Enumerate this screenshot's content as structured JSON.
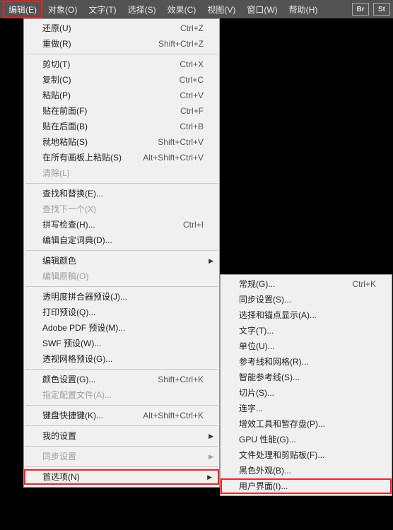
{
  "menubar": {
    "items": [
      "编辑(E)",
      "对象(O)",
      "文字(T)",
      "选择(S)",
      "效果(C)",
      "视图(V)",
      "窗口(W)",
      "帮助(H)"
    ],
    "icons": [
      "Br",
      "St"
    ]
  },
  "mainMenu": [
    {
      "type": "item",
      "label": "还原(U)",
      "shortcut": "Ctrl+Z"
    },
    {
      "type": "item",
      "label": "重做(R)",
      "shortcut": "Shift+Ctrl+Z"
    },
    {
      "type": "sep"
    },
    {
      "type": "item",
      "label": "剪切(T)",
      "shortcut": "Ctrl+X"
    },
    {
      "type": "item",
      "label": "复制(C)",
      "shortcut": "Ctrl+C"
    },
    {
      "type": "item",
      "label": "粘贴(P)",
      "shortcut": "Ctrl+V"
    },
    {
      "type": "item",
      "label": "贴在前面(F)",
      "shortcut": "Ctrl+F"
    },
    {
      "type": "item",
      "label": "贴在后面(B)",
      "shortcut": "Ctrl+B"
    },
    {
      "type": "item",
      "label": "就地粘贴(S)",
      "shortcut": "Shift+Ctrl+V"
    },
    {
      "type": "item",
      "label": "在所有画板上粘贴(S)",
      "shortcut": "Alt+Shift+Ctrl+V"
    },
    {
      "type": "item",
      "label": "清除(L)",
      "disabled": true
    },
    {
      "type": "sep"
    },
    {
      "type": "item",
      "label": "查找和替换(E)..."
    },
    {
      "type": "item",
      "label": "查找下一个(X)",
      "disabled": true
    },
    {
      "type": "item",
      "label": "拼写检查(H)...",
      "shortcut": "Ctrl+I"
    },
    {
      "type": "item",
      "label": "编辑自定词典(D)..."
    },
    {
      "type": "sep"
    },
    {
      "type": "item",
      "label": "编辑颜色",
      "submenu": true
    },
    {
      "type": "item",
      "label": "编辑原稿(O)",
      "disabled": true
    },
    {
      "type": "sep"
    },
    {
      "type": "item",
      "label": "透明度拼合器预设(J)..."
    },
    {
      "type": "item",
      "label": "打印预设(Q)..."
    },
    {
      "type": "item",
      "label": "Adobe PDF 预设(M)..."
    },
    {
      "type": "item",
      "label": "SWF 预设(W)..."
    },
    {
      "type": "item",
      "label": "透视网格预设(G)..."
    },
    {
      "type": "sep"
    },
    {
      "type": "item",
      "label": "颜色设置(G)...",
      "shortcut": "Shift+Ctrl+K"
    },
    {
      "type": "item",
      "label": "指定配置文件(A)...",
      "disabled": true
    },
    {
      "type": "sep"
    },
    {
      "type": "item",
      "label": "键盘快捷键(K)...",
      "shortcut": "Alt+Shift+Ctrl+K"
    },
    {
      "type": "sep"
    },
    {
      "type": "item",
      "label": "我的设置",
      "submenu": true
    },
    {
      "type": "sep"
    },
    {
      "type": "item",
      "label": "同步设置",
      "submenu": true,
      "disabled": true
    },
    {
      "type": "sep"
    },
    {
      "type": "item",
      "label": "首选项(N)",
      "submenu": true,
      "highlight": "main"
    }
  ],
  "subMenu": [
    {
      "type": "item",
      "label": "常规(G)...",
      "shortcut": "Ctrl+K"
    },
    {
      "type": "item",
      "label": "同步设置(S)..."
    },
    {
      "type": "item",
      "label": "选择和锚点显示(A)..."
    },
    {
      "type": "item",
      "label": "文字(T)..."
    },
    {
      "type": "item",
      "label": "单位(U)..."
    },
    {
      "type": "item",
      "label": "参考线和网格(R)..."
    },
    {
      "type": "item",
      "label": "智能参考线(S)..."
    },
    {
      "type": "item",
      "label": "切片(S)..."
    },
    {
      "type": "item",
      "label": "连字..."
    },
    {
      "type": "item",
      "label": "增效工具和暂存盘(P)..."
    },
    {
      "type": "item",
      "label": "GPU 性能(G)..."
    },
    {
      "type": "item",
      "label": "文件处理和剪贴板(F)..."
    },
    {
      "type": "item",
      "label": "黑色外观(B)..."
    },
    {
      "type": "item",
      "label": "用户界面(I)...",
      "highlight": "sub"
    }
  ]
}
